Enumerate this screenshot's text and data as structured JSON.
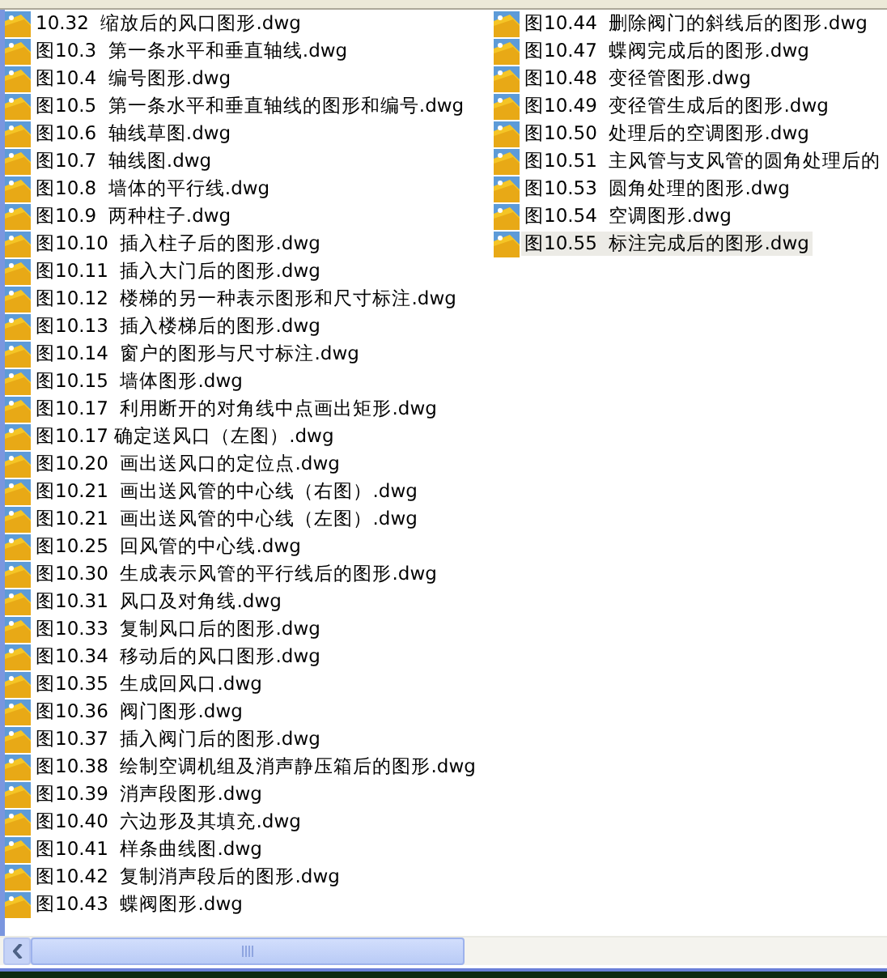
{
  "files": [
    {
      "name": "10.32  缩放后的风口图形.dwg",
      "selected": false
    },
    {
      "name": "图10.3  第一条水平和垂直轴线.dwg",
      "selected": false
    },
    {
      "name": "图10.4  编号图形.dwg",
      "selected": false
    },
    {
      "name": "图10.5  第一条水平和垂直轴线的图形和编号.dwg",
      "selected": false
    },
    {
      "name": "图10.6  轴线草图.dwg",
      "selected": false
    },
    {
      "name": "图10.7  轴线图.dwg",
      "selected": false
    },
    {
      "name": "图10.8  墙体的平行线.dwg",
      "selected": false
    },
    {
      "name": "图10.9  两种柱子.dwg",
      "selected": false
    },
    {
      "name": "图10.10  插入柱子后的图形.dwg",
      "selected": false
    },
    {
      "name": "图10.11  插入大门后的图形.dwg",
      "selected": false
    },
    {
      "name": "图10.12  楼梯的另一种表示图形和尺寸标注.dwg",
      "selected": false
    },
    {
      "name": "图10.13  插入楼梯后的图形.dwg",
      "selected": false
    },
    {
      "name": "图10.14  窗户的图形与尺寸标注.dwg",
      "selected": false
    },
    {
      "name": "图10.15  墙体图形.dwg",
      "selected": false
    },
    {
      "name": "图10.17  利用断开的对角线中点画出矩形.dwg",
      "selected": false
    },
    {
      "name": "图10.17 确定送风口（左图）.dwg",
      "selected": false
    },
    {
      "name": "图10.20  画出送风口的定位点.dwg",
      "selected": false
    },
    {
      "name": "图10.21  画出送风管的中心线（右图）.dwg",
      "selected": false
    },
    {
      "name": "图10.21  画出送风管的中心线（左图）.dwg",
      "selected": false
    },
    {
      "name": "图10.25  回风管的中心线.dwg",
      "selected": false
    },
    {
      "name": "图10.30  生成表示风管的平行线后的图形.dwg",
      "selected": false
    },
    {
      "name": "图10.31  风口及对角线.dwg",
      "selected": false
    },
    {
      "name": "图10.33  复制风口后的图形.dwg",
      "selected": false
    },
    {
      "name": "图10.34  移动后的风口图形.dwg",
      "selected": false
    },
    {
      "name": "图10.35  生成回风口.dwg",
      "selected": false
    },
    {
      "name": "图10.36  阀门图形.dwg",
      "selected": false
    },
    {
      "name": "图10.37  插入阀门后的图形.dwg",
      "selected": false
    },
    {
      "name": "图10.38  绘制空调机组及消声静压箱后的图形.dwg",
      "selected": false
    },
    {
      "name": "图10.39  消声段图形.dwg",
      "selected": false
    },
    {
      "name": "图10.40  六边形及其填充.dwg",
      "selected": false
    },
    {
      "name": "图10.41  样条曲线图.dwg",
      "selected": false
    },
    {
      "name": "图10.42  复制消声段后的图形.dwg",
      "selected": false
    },
    {
      "name": "图10.43  蝶阀图形.dwg",
      "selected": false
    },
    {
      "name": "图10.44  删除阀门的斜线后的图形.dwg",
      "selected": false
    },
    {
      "name": "图10.47  蝶阀完成后的图形.dwg",
      "selected": false
    },
    {
      "name": "图10.48  变径管图形.dwg",
      "selected": false
    },
    {
      "name": "图10.49  变径管生成后的图形.dwg",
      "selected": false
    },
    {
      "name": "图10.50  处理后的空调图形.dwg",
      "selected": false
    },
    {
      "name": "图10.51  主风管与支风管的圆角处理后的",
      "selected": false
    },
    {
      "name": "图10.53  圆角处理的图形.dwg",
      "selected": false
    },
    {
      "name": "图10.54  空调图形.dwg",
      "selected": false
    },
    {
      "name": "图10.55  标注完成后的图形.dwg",
      "selected": true
    }
  ]
}
